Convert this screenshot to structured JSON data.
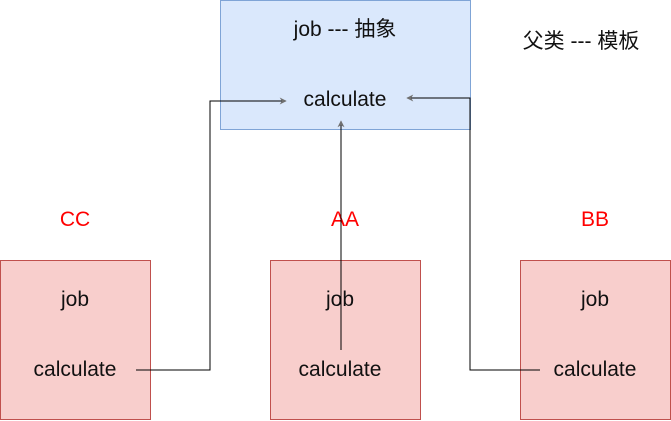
{
  "parent": {
    "title": "job --- 抽象",
    "method": "calculate"
  },
  "note": "父类 --- 模板",
  "children": [
    {
      "name": "CC",
      "field": "job",
      "method": "calculate"
    },
    {
      "name": "AA",
      "field": "job",
      "method": "calculate"
    },
    {
      "name": "BB",
      "field": "job",
      "method": "calculate"
    }
  ],
  "colors": {
    "parent_fill": "#dae8fc",
    "child_fill": "#f8cecc",
    "class_label": "#ff0000"
  }
}
